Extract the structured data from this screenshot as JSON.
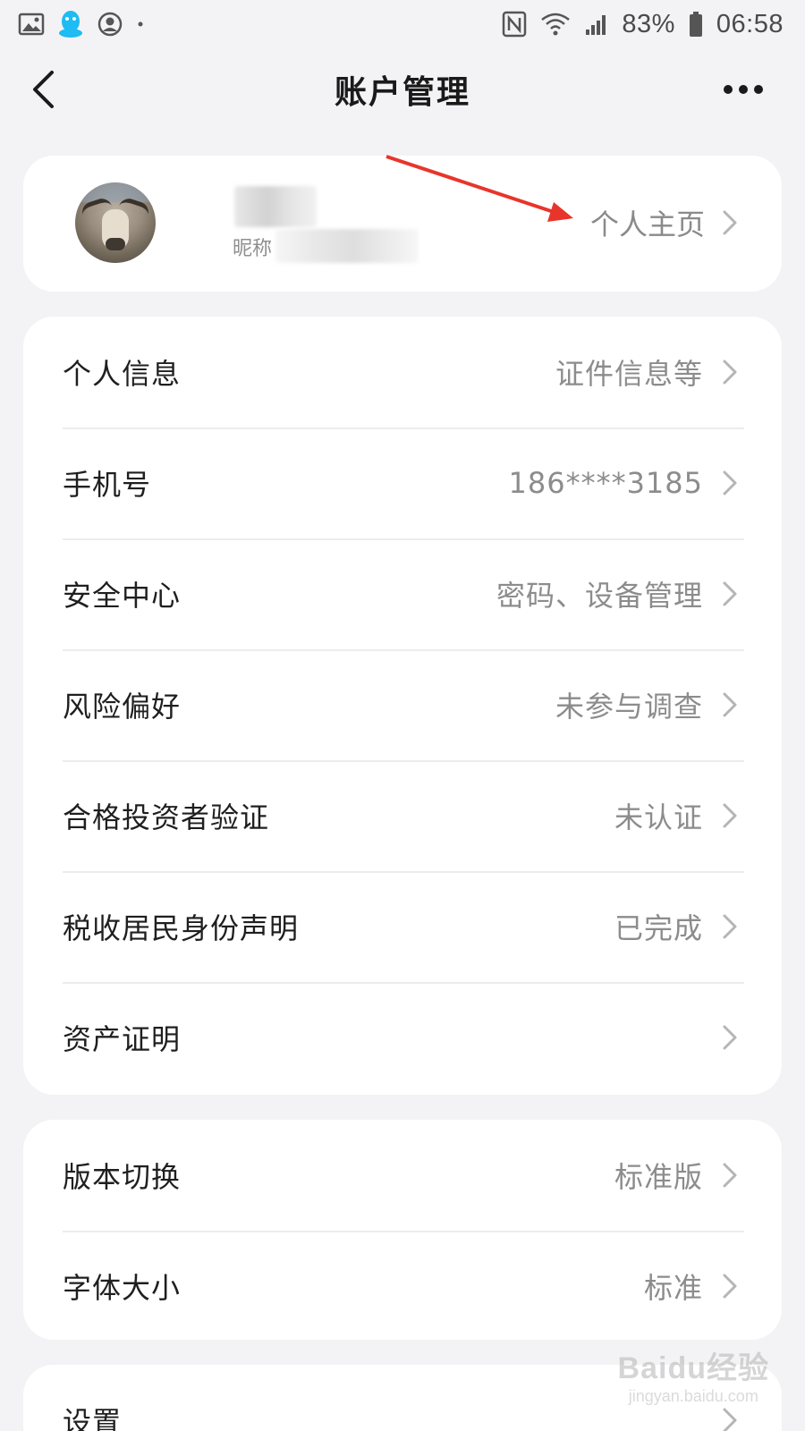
{
  "status_bar": {
    "battery": "83%",
    "time": "06:58",
    "icons": [
      "gallery-icon",
      "qq-icon",
      "account-circle-icon",
      "dot-icon",
      "nfc-icon",
      "wifi-icon",
      "signal-icon",
      "battery-icon"
    ]
  },
  "nav": {
    "title": "账户管理",
    "back_icon": "chevron-left-icon",
    "more_icon": "more-icon"
  },
  "profile": {
    "nickname_label": "昵称",
    "homepage_link": "个人主页"
  },
  "groups": [
    {
      "items": [
        {
          "label": "个人信息",
          "value": "证件信息等"
        },
        {
          "label": "手机号",
          "value": "186****3185"
        },
        {
          "label": "安全中心",
          "value": "密码、设备管理"
        },
        {
          "label": "风险偏好",
          "value": "未参与调查"
        },
        {
          "label": "合格投资者验证",
          "value": "未认证"
        },
        {
          "label": "税收居民身份声明",
          "value": "已完成"
        },
        {
          "label": "资产证明",
          "value": ""
        }
      ]
    },
    {
      "items": [
        {
          "label": "版本切换",
          "value": "标准版"
        },
        {
          "label": "字体大小",
          "value": "标准"
        }
      ]
    },
    {
      "items": [
        {
          "label": "设置",
          "value": ""
        }
      ]
    }
  ],
  "watermark": {
    "main": "Baidu经验",
    "sub": "jingyan.baidu.com"
  },
  "colors": {
    "background": "#f3f3f5",
    "card": "#ffffff",
    "annotation_arrow": "#e8352b",
    "qq_blue": "#1ebcf2"
  }
}
